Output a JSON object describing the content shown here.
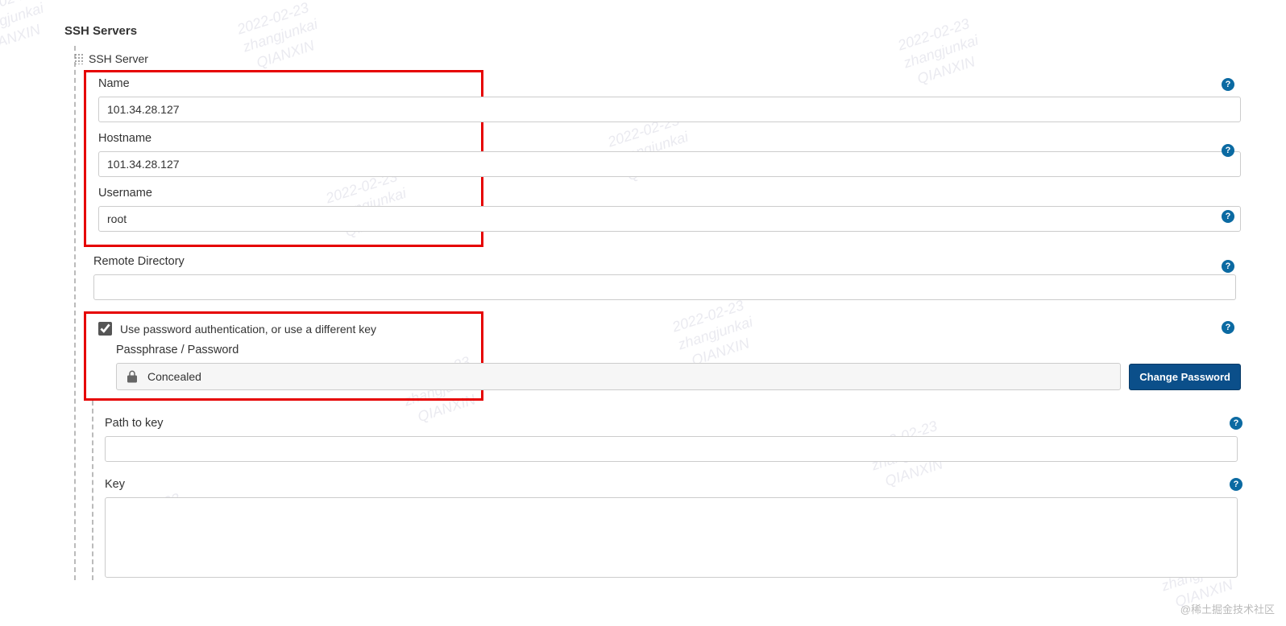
{
  "section_title": "SSH Servers",
  "server": {
    "header": "SSH Server",
    "name_label": "Name",
    "name_value": "101.34.28.127",
    "hostname_label": "Hostname",
    "hostname_value": "101.34.28.127",
    "username_label": "Username",
    "username_value": "root",
    "remote_dir_label": "Remote Directory",
    "remote_dir_value": "",
    "use_password_label": "Use password authentication, or use a different key",
    "use_password_checked": true,
    "passphrase_label": "Passphrase / Password",
    "concealed_text": "Concealed",
    "change_password_btn": "Change Password",
    "path_to_key_label": "Path to key",
    "path_to_key_value": "",
    "key_label": "Key",
    "key_value": ""
  },
  "watermark": {
    "line1": "2022-02-23",
    "line2": "zhangjunkai",
    "line3": "QIANXIN"
  },
  "footer": "@稀土掘金技术社区"
}
